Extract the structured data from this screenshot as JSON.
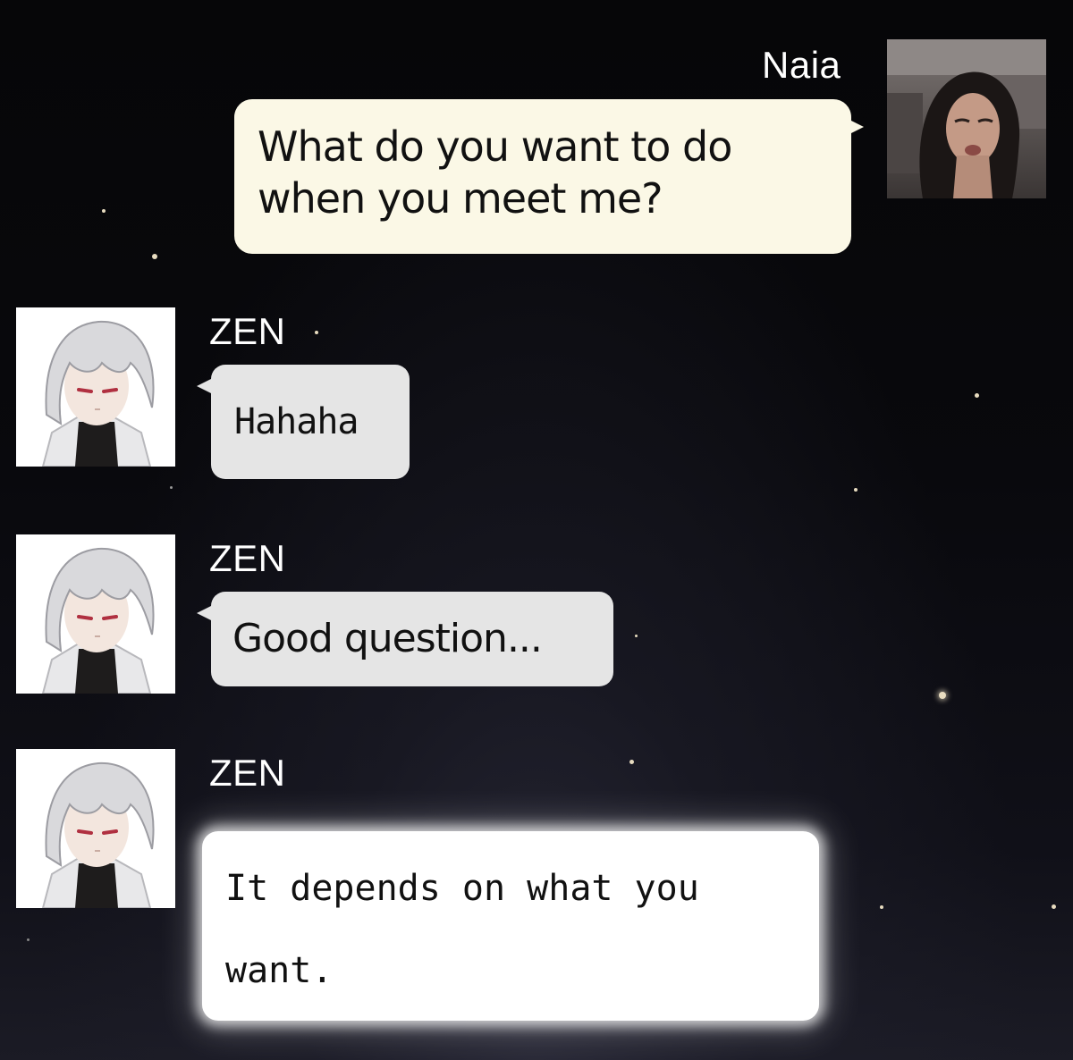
{
  "messages": [
    {
      "sender": "Naia",
      "text_line1": "What do you want to do",
      "text_line2": "when you meet me?"
    },
    {
      "sender": "ZEN",
      "text": "Hahaha"
    },
    {
      "sender": "ZEN",
      "text": "Good question..."
    },
    {
      "sender": "ZEN",
      "text_line1": "It depends on what you",
      "text_line2": "want."
    }
  ],
  "avatars": {
    "naia": "user-photo",
    "zen": "zen-portrait"
  },
  "colors": {
    "background": "#09090d",
    "user_bubble": "#fbf8e6",
    "zen_bubble": "#e5e5e5",
    "highlight_bubble": "#ffffff",
    "name_text": "#ffffff"
  }
}
